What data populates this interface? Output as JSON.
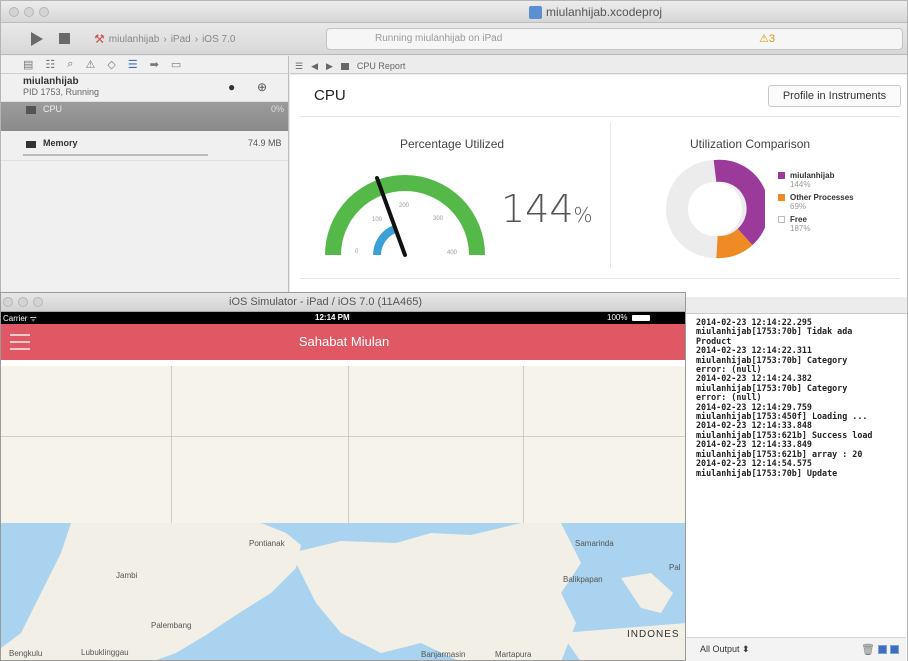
{
  "xcode": {
    "window_title": "miulanhijab.xcodeproj",
    "scheme": [
      "miulanhijab",
      "iPad",
      "iOS 7.0"
    ],
    "activity_text": "Running miulanhijab on iPad",
    "warning_count": "3",
    "process_name": "miulanhijab",
    "process_status": "PID 1753, Running",
    "gauges": [
      {
        "label": "CPU",
        "value": "0%"
      },
      {
        "label": "Memory",
        "value": "74.9 MB"
      }
    ],
    "jump_bar": "CPU Report",
    "report": {
      "title": "CPU",
      "profile_button": "Profile in Instruments",
      "pct_title": "Percentage Utilized",
      "pct_value": "144",
      "pct_unit": "%",
      "gauge_ticks": [
        "0",
        "100",
        "200",
        "300",
        "400"
      ],
      "comparison_title": "Utilization Comparison",
      "legend": [
        {
          "name": "miulanhijab",
          "value": "144%",
          "color": "#9b3a9a"
        },
        {
          "name": "Other Processes",
          "value": "69%",
          "color": "#ef8b24"
        },
        {
          "name": "Free",
          "value": "187%",
          "color": "#eaeaea"
        }
      ]
    },
    "console_lines": [
      "2014-02-23 12:14:22.295",
      "miulanhijab[1753:70b] Tidak ada",
      "Product",
      "2014-02-23 12:14:22.311",
      "miulanhijab[1753:70b] Category",
      "error: (null)",
      "2014-02-23 12:14:24.382",
      "miulanhijab[1753:70b] Category",
      "error: (null)",
      "2014-02-23 12:14:29.759",
      "miulanhijab[1753:450f] Loading ...",
      "2014-02-23 12:14:33.848",
      "miulanhijab[1753:621b] Success load",
      "2014-02-23 12:14:33.849",
      "miulanhijab[1753:621b] array : 20",
      "2014-02-23 12:14:54.575",
      "miulanhijab[1753:70b] Update"
    ],
    "console_output_select": "All Output ⬍"
  },
  "simulator": {
    "window_title": "iOS Simulator - iPad / iOS 7.0 (11A465)",
    "carrier": "Carrier ᯤ",
    "time": "12:14 PM",
    "battery": "100%",
    "app_title": "Sahabat Miulan",
    "map_labels": [
      "Pontianak",
      "Samarinda",
      "Jambi",
      "Balikpapan",
      "Pal",
      "Palembang",
      "INDONES",
      "Bengkulu",
      "Lubuklinggau",
      "Banjarmasin",
      "Martapura"
    ]
  }
}
